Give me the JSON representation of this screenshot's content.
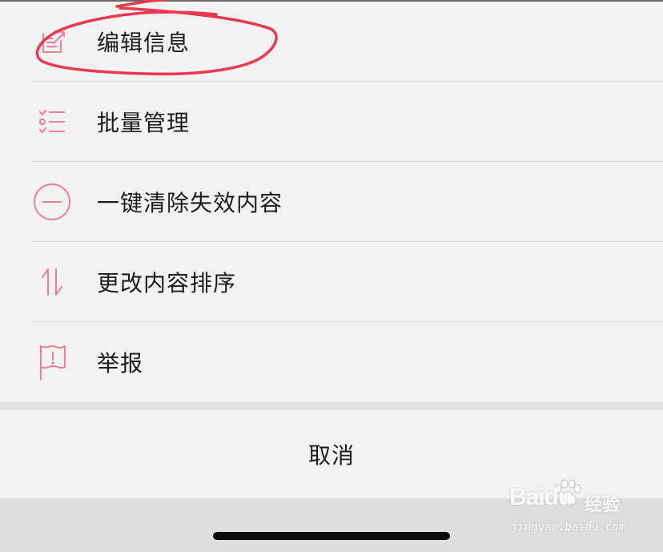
{
  "menu": {
    "items": [
      {
        "label": "编辑信息",
        "icon": "edit-icon"
      },
      {
        "label": "批量管理",
        "icon": "checklist-icon"
      },
      {
        "label": "一键清除失效内容",
        "icon": "minus-circle-icon"
      },
      {
        "label": "更改内容排序",
        "icon": "sort-arrows-icon"
      },
      {
        "label": "举报",
        "icon": "report-flag-icon"
      }
    ]
  },
  "cancel_label": "取消",
  "colors": {
    "icon_accent": "#ee7f98",
    "annotation": "#e8394f",
    "background": "#f3f2f3",
    "text": "#1c1c1c"
  },
  "watermark": {
    "brand": "Baidu",
    "suffix": "经验",
    "url": "jingyan.baidu.com"
  }
}
